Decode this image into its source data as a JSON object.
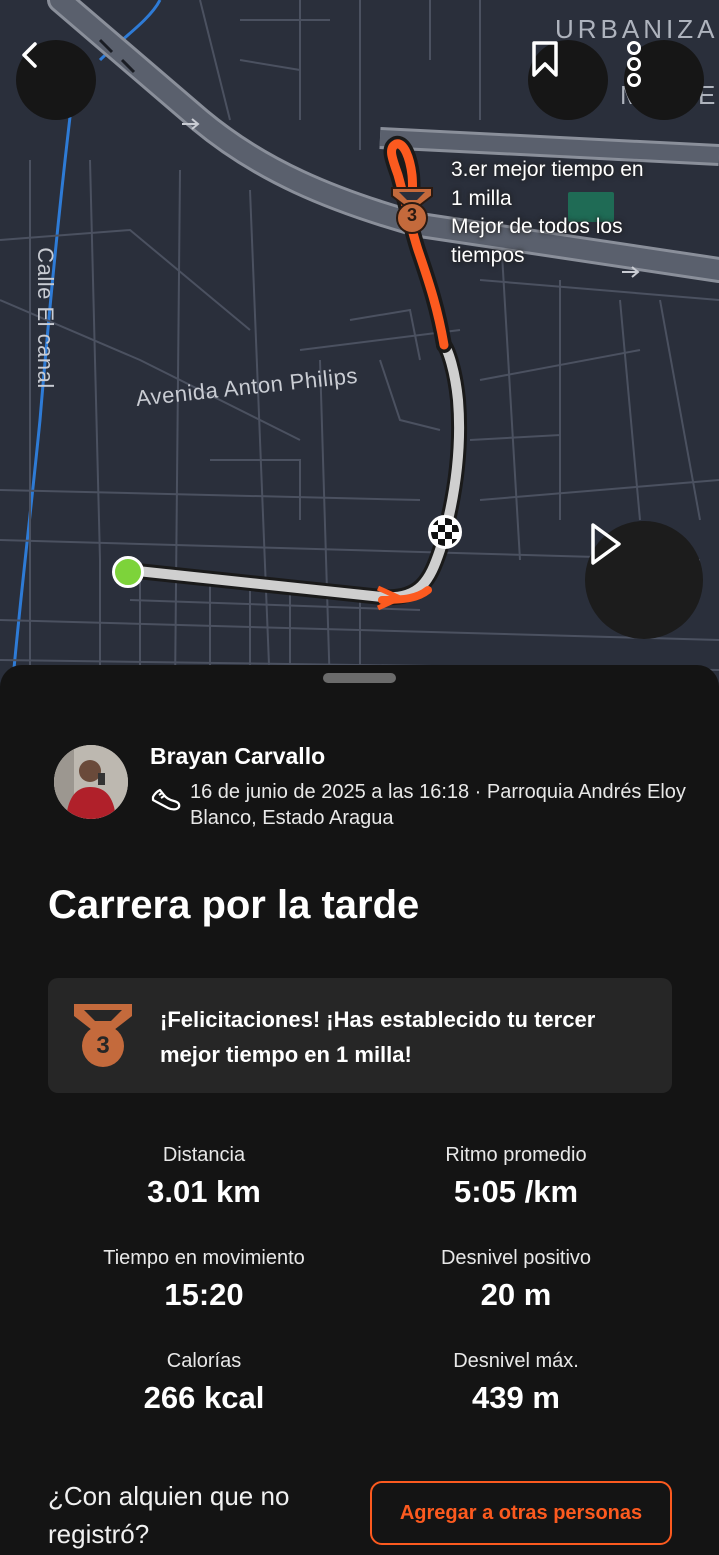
{
  "map": {
    "labels": {
      "urbaniza": "URBANIZA",
      "n": "N",
      "m": "M",
      "e": "E",
      "street1": "Calle El canal",
      "street2": "Avenida Anton Philips"
    },
    "pr_text": "3.er mejor tiempo en 1 milla\nMejor de todos los tiempos",
    "pr_line1": "3.er mejor tiempo en",
    "pr_line2": "1 milla",
    "pr_line3": "Mejor de todos los",
    "pr_line4": "tiempos",
    "medal_rank": "3",
    "colors": {
      "route_active": "#fc5a1f",
      "route_inactive": "#cfcfcf",
      "start": "#7dd33a",
      "background": "#2a2f3b",
      "water": "#2e7bd6"
    },
    "buttons": {
      "back": "back-icon",
      "save": "bookmark-icon",
      "more": "more-vertical-icon",
      "play": "play-icon"
    }
  },
  "activity": {
    "athlete_name": "Brayan Carvallo",
    "meta": "16 de junio de 2025 a las 16:18 · Parroquia Andrés Eloy Blanco, Estado Aragua",
    "sport_icon": "running-shoe-icon",
    "title": "Carrera por la tarde"
  },
  "achievement": {
    "rank": "3",
    "message": "¡Felicitaciones! ¡Has establecido tu tercer mejor tiempo en 1 milla!"
  },
  "stats": [
    {
      "label": "Distancia",
      "value": "3.01 km"
    },
    {
      "label": "Ritmo promedio",
      "value": "5:05 /km"
    },
    {
      "label": "Tiempo en movimiento",
      "value": "15:20"
    },
    {
      "label": "Desnivel positivo",
      "value": "20 m"
    },
    {
      "label": "Calorías",
      "value": "266 kcal"
    },
    {
      "label": "Desnivel máx.",
      "value": "439 m"
    }
  ],
  "footer": {
    "prompt": "¿Con alquien que no registró?",
    "add_button": "Agregar a otras personas"
  },
  "accent": "#fc5a1f"
}
